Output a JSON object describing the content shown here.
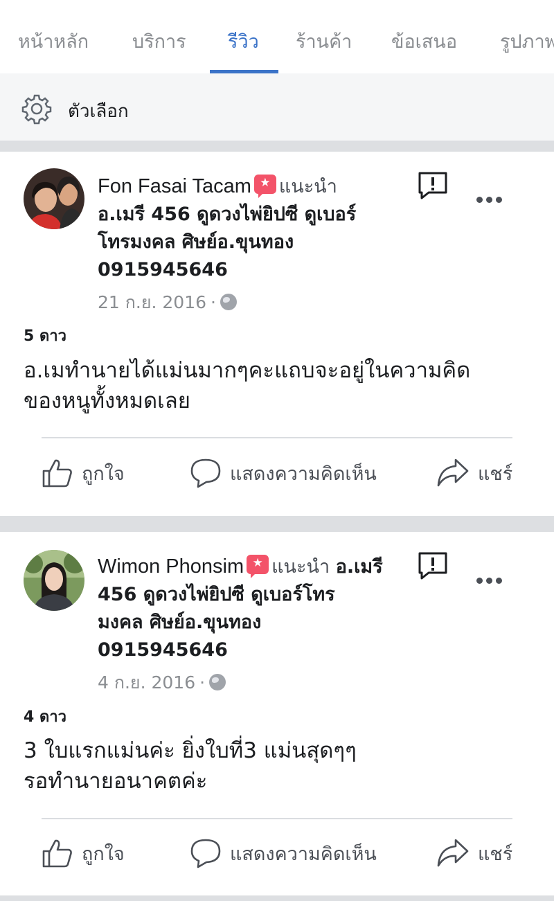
{
  "tabs": {
    "items": [
      "หน้าหลัก",
      "บริการ",
      "รีวิว",
      "ร้านค้า",
      "ข้อเสนอ",
      "รูปภาพ"
    ],
    "active_index": 2
  },
  "options": {
    "label": "ตัวเลือก"
  },
  "reviews": [
    {
      "author": "Fon Fasai Tacam",
      "recommends": "แนะนำ",
      "page_line1": "อ.เมรี 456 ดูดวงไพ่ยิปซี ดูเบอร์",
      "page_line2": "โทรมงคล ศิษย์อ.ขุนทอง",
      "page_line3": "0915945646",
      "date": "21 ก.ย. 2016",
      "rating": "5 ดาว",
      "text_line1": "อ.เมทำนายได้แม่นมากๆคะแถบจะอยู่ในความคิด",
      "text_line2": "ของหนูทั้งหมดเลย"
    },
    {
      "author": "Wimon Phonsim",
      "recommends": "แนะนำ",
      "page_line1": "อ.เมรี",
      "page_line2": "456 ดูดวงไพ่ยิปซี ดูเบอร์โทร",
      "page_line3": "มงคล ศิษย์อ.ขุนทอง",
      "page_line4": "0915945646",
      "date": "4 ก.ย. 2016",
      "rating": "4 ดาว",
      "text_line1": "3 ใบแรกแม่นค่ะ ยิ่งใบที่3 แม่นสุดๆๆ",
      "text_line2": "รอทำนายอนาคตค่ะ"
    }
  ],
  "actions": {
    "like": "ถูกใจ",
    "comment": "แสดงความคิดเห็น",
    "share": "แชร์"
  },
  "colors": {
    "accent": "#3b73c8",
    "badge": "#f35369",
    "text_secondary": "#8a8d91"
  }
}
